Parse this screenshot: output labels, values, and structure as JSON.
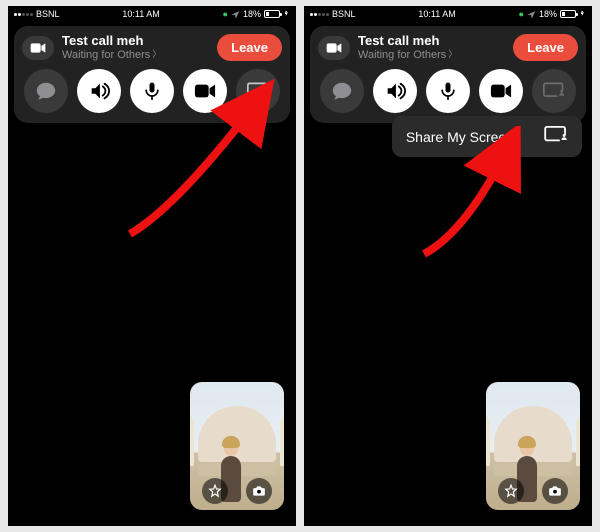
{
  "status": {
    "carrier": "BSNL",
    "time": "10:11 AM",
    "battery_pct": "18%"
  },
  "call": {
    "title": "Test call meh",
    "subtitle": "Waiting for Others",
    "leave_label": "Leave"
  },
  "share": {
    "label": "Share My Screen"
  }
}
